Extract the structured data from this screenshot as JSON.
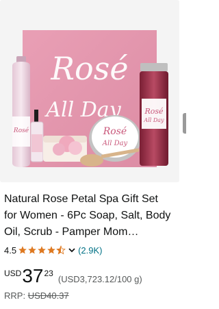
{
  "product": {
    "image_alt": "Rose All Day spa gift set product photo",
    "brand_script": "Rosé",
    "brand_script2": "All Day",
    "title": "Natural Rose Petal Spa Gift Set for Women - 6Pc Soap, Salt, Body Oil, Scrub - Pamper Mom…",
    "rating_value": "4.5",
    "rating_stars": 4.5,
    "rating_count": "(2.9K)",
    "price_currency": "USD",
    "price_whole": "37",
    "price_fraction": "23",
    "unit_price": "(USD3,723.12/100 g)",
    "rrp_label": "RRP:",
    "rrp_value": "USD40.37",
    "colors": {
      "star": "#de7921",
      "link": "#007185",
      "box_pink": "#e8a0b4",
      "title_text": "#0f1111",
      "muted_text": "#565959"
    }
  },
  "icons": {
    "star": "star-icon",
    "chevron": "chevron-down-icon"
  }
}
